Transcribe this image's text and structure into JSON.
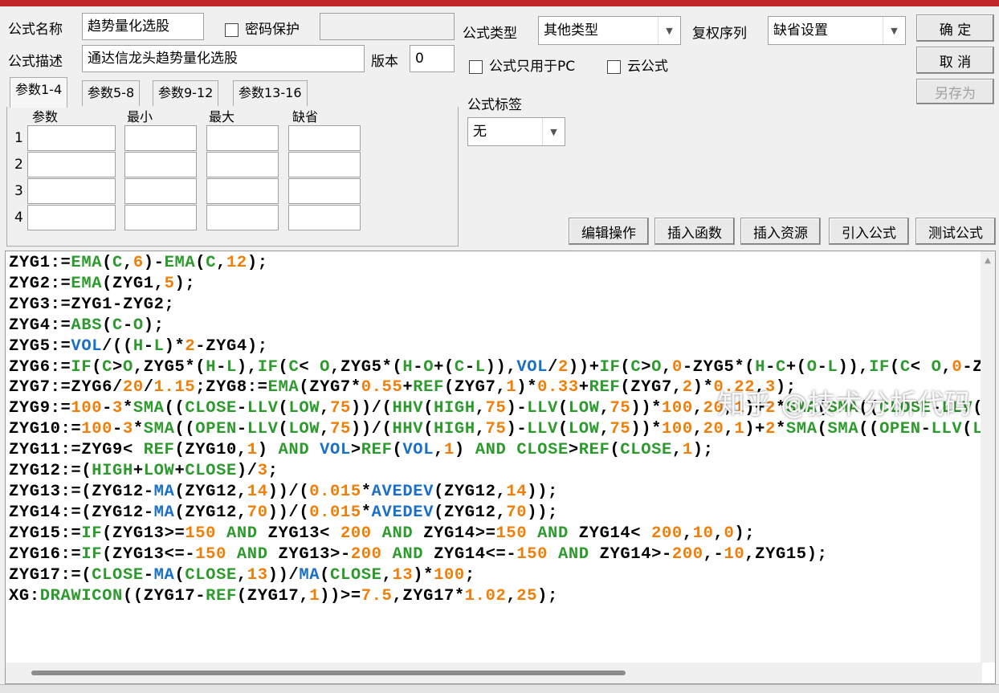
{
  "window": {
    "title_color": "#c0282c"
  },
  "form": {
    "name_label": "公式名称",
    "name_value": "趋势量化选股",
    "password_label": "密码保护",
    "password_checked": false,
    "password_value": "",
    "desc_label": "公式描述",
    "desc_value": "通达信龙头趋势量化选股",
    "version_label": "版本",
    "version_value": "0",
    "type_label": "公式类型",
    "type_value": "其他类型",
    "rights_label": "复权序列",
    "rights_value": "缺省设置",
    "pc_only_label": "公式只用于PC",
    "pc_only_checked": false,
    "cloud_label": "云公式",
    "cloud_checked": false,
    "tag_label": "公式标签",
    "tag_value": "无"
  },
  "buttons": {
    "ok": "确  定",
    "cancel": "取  消",
    "save_as": "另存为",
    "edit_ops": "编辑操作",
    "insert_func": "插入函数",
    "insert_res": "插入资源",
    "import_formula": "引入公式",
    "test_formula": "测试公式"
  },
  "params": {
    "tabs": [
      "参数1-4",
      "参数5-8",
      "参数9-12",
      "参数13-16"
    ],
    "active_tab": 0,
    "headers": [
      "参数",
      "最小",
      "最大",
      "缺省"
    ],
    "rows": [
      "1",
      "2",
      "3",
      "4"
    ]
  },
  "editor": {
    "lines": [
      "ZYG1:=EMA(C,6)-EMA(C,12);",
      "ZYG2:=EMA(ZYG1,5);",
      "ZYG3:=ZYG1-ZYG2;",
      "ZYG4:=ABS(C-O);",
      "ZYG5:=VOL/((H-L)*2-ZYG4);",
      "ZYG6:=IF(C>O,ZYG5*(H-L),IF(C< O,ZYG5*(H-O+(C-L)),VOL/2))+IF(C>O,0-ZYG5*(H-C+(O-L)),IF(C< O,0-Z",
      "ZYG7:=ZYG6/20/1.15;ZYG8:=EMA(ZYG7*0.55+REF(ZYG7,1)*0.33+REF(ZYG7,2)*0.22,3);",
      "ZYG9:=100-3*SMA((CLOSE-LLV(LOW,75))/(HHV(HIGH,75)-LLV(LOW,75))*100,20,1)+2*SMA(SMA((CLOSE-LLV(",
      "ZYG10:=100-3*SMA((OPEN-LLV(LOW,75))/(HHV(HIGH,75)-LLV(LOW,75))*100,20,1)+2*SMA(SMA((OPEN-LLV(L",
      "ZYG11:=ZYG9< REF(ZYG10,1) AND VOL>REF(VOL,1) AND CLOSE>REF(CLOSE,1);",
      "ZYG12:=(HIGH+LOW+CLOSE)/3;",
      "ZYG13:=(ZYG12-MA(ZYG12,14))/(0.015*AVEDEV(ZYG12,14));",
      "ZYG14:=(ZYG12-MA(ZYG12,70))/(0.015*AVEDEV(ZYG12,70));",
      "ZYG15:=IF(ZYG13>=150 AND ZYG13< 200 AND ZYG14>=150 AND ZYG14< 200,10,0);",
      "ZYG16:=IF(ZYG13<=-150 AND ZYG13>-200 AND ZYG14<=-150 AND ZYG14>-200,-10,ZYG15);",
      "ZYG17:=(CLOSE-MA(CLOSE,13))/MA(CLOSE,13)*100;",
      "XG:DRAWICON((ZYG17-REF(ZYG17,1))>=7.5,ZYG17*1.02,25);"
    ],
    "colors": {
      "function": "#2d9a2d",
      "number": "#f07f0a",
      "special": "#1a6fc9"
    }
  },
  "watermark": "知乎 @技术分析代码"
}
